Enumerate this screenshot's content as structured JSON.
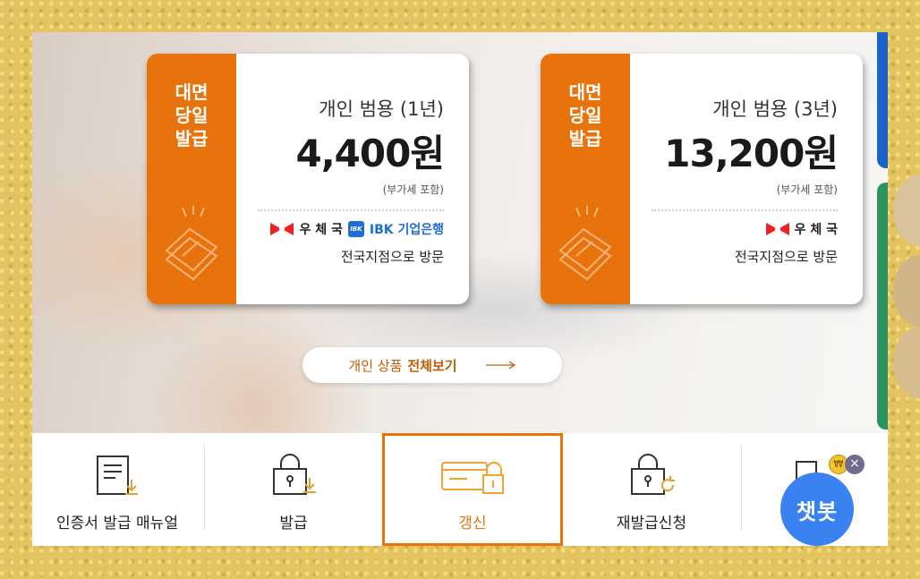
{
  "cards": [
    {
      "tag": "대면\n당일\n발급",
      "product": "개인 범용 (1년)",
      "price": "4,400원",
      "vat": "(부가세 포함)",
      "partner_post": "우 체 국",
      "partner_ibk_mark": "IBK",
      "partner_ibk": "IBK 기업은행",
      "visit": "전국지점으로 방문"
    },
    {
      "tag": "대면\n당일\n발급",
      "product": "개인 범용 (3년)",
      "price": "13,200원",
      "vat": "(부가세 포함)",
      "partner_post": "우 체 국",
      "visit": "전국지점으로 방문"
    }
  ],
  "view_all": {
    "prefix": "개인 상품",
    "bold": "전체보기"
  },
  "menu": [
    {
      "label": "인증서 발급 매뉴얼",
      "icon": "manual-download-icon"
    },
    {
      "label": "발급",
      "icon": "lock-download-icon"
    },
    {
      "label": "갱신",
      "icon": "card-lock-icon",
      "active": true
    },
    {
      "label": "재발급신청",
      "icon": "lock-refresh-icon"
    }
  ],
  "chatbot": {
    "label": "챗봇",
    "close": "×",
    "coin": "₩"
  },
  "colors": {
    "accent": "#e8730c",
    "blue": "#1c63c9",
    "green": "#2c9360",
    "chatbot": "#3a82f0"
  }
}
